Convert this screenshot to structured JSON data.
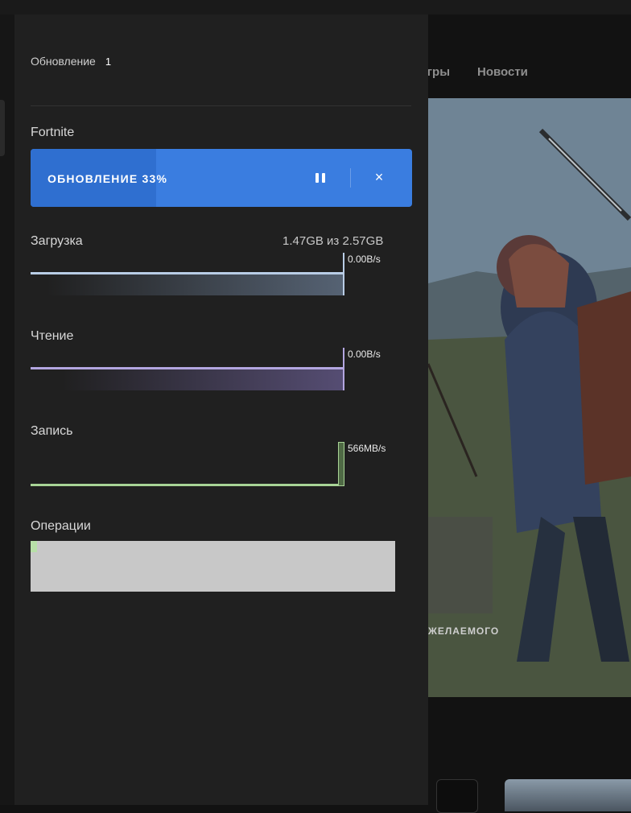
{
  "background": {
    "nav": [
      "Игры",
      "Новости"
    ],
    "hero_caption": "ЖЕЛАЕМОГО"
  },
  "panel": {
    "header_label": "Обновление",
    "header_count": "1",
    "game_title": "Fortnite",
    "update_button": {
      "label": "ОБНОВЛЕНИЕ 33%",
      "progress_fraction": 0.33,
      "pause_icon": "pause-icon",
      "close_icon": "close-icon"
    },
    "download": {
      "label": "Загрузка",
      "amount": "1.47GB из 2.57GB",
      "rate": "0.00B/s",
      "color": "#b9cde6"
    },
    "read": {
      "label": "Чтение",
      "rate": "0.00B/s",
      "color": "#b3a6e0"
    },
    "write": {
      "label": "Запись",
      "rate": "566MB/s",
      "color": "#a8d496"
    },
    "operations": {
      "label": "Операции"
    }
  }
}
